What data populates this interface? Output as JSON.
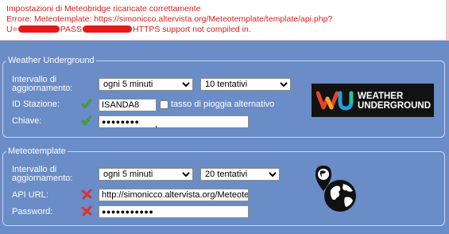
{
  "alert": {
    "line1": "Impostazioni di Meteobridge ricaricate correttamente",
    "line2": "Errore: Meteotemplate: https://simonicco.altervista.org/Meteotemplate/template/api.php?",
    "line3_prefix": "U=",
    "line3_middle": "PASS",
    "line3_suffix": "HTTPS support not compiled in."
  },
  "wu": {
    "legend": "Weather Underground",
    "interval_label_1": "Intervallo di",
    "interval_label_2": "aggiornamento:",
    "interval_value": "ogni 5 minuti",
    "retries_value": "10 tentativi",
    "station_label": "ID Stazione:",
    "station_value": "ISANDA8",
    "alt_rain_label": "tasso di pioggia alternativo",
    "alt_rain_checked": false,
    "key_label": "Chiave:",
    "key_value": "●●●●●●●●",
    "logo_line1": "WEATHER",
    "logo_line2": "UNDERGROUND"
  },
  "mt": {
    "legend": "Meteotemplate",
    "interval_label_1": "Intervallo di",
    "interval_label_2": "aggiornamento:",
    "interval_value": "ogni 5 minuti",
    "retries_value": "20 tentativi",
    "api_label": "API URL:",
    "api_value": "http://simonicco.altervista.org/Meteote",
    "password_label": "Password:",
    "password_value": "●●●●●●●●●●●"
  },
  "colors": {
    "background": "#6a8cc7",
    "error_text": "#e02020",
    "ok_tick": "#46b41e",
    "error_cross": "#e03030"
  },
  "icons": [
    "check-icon",
    "cross-icon",
    "weather-underground-logo",
    "globe-icon"
  ]
}
